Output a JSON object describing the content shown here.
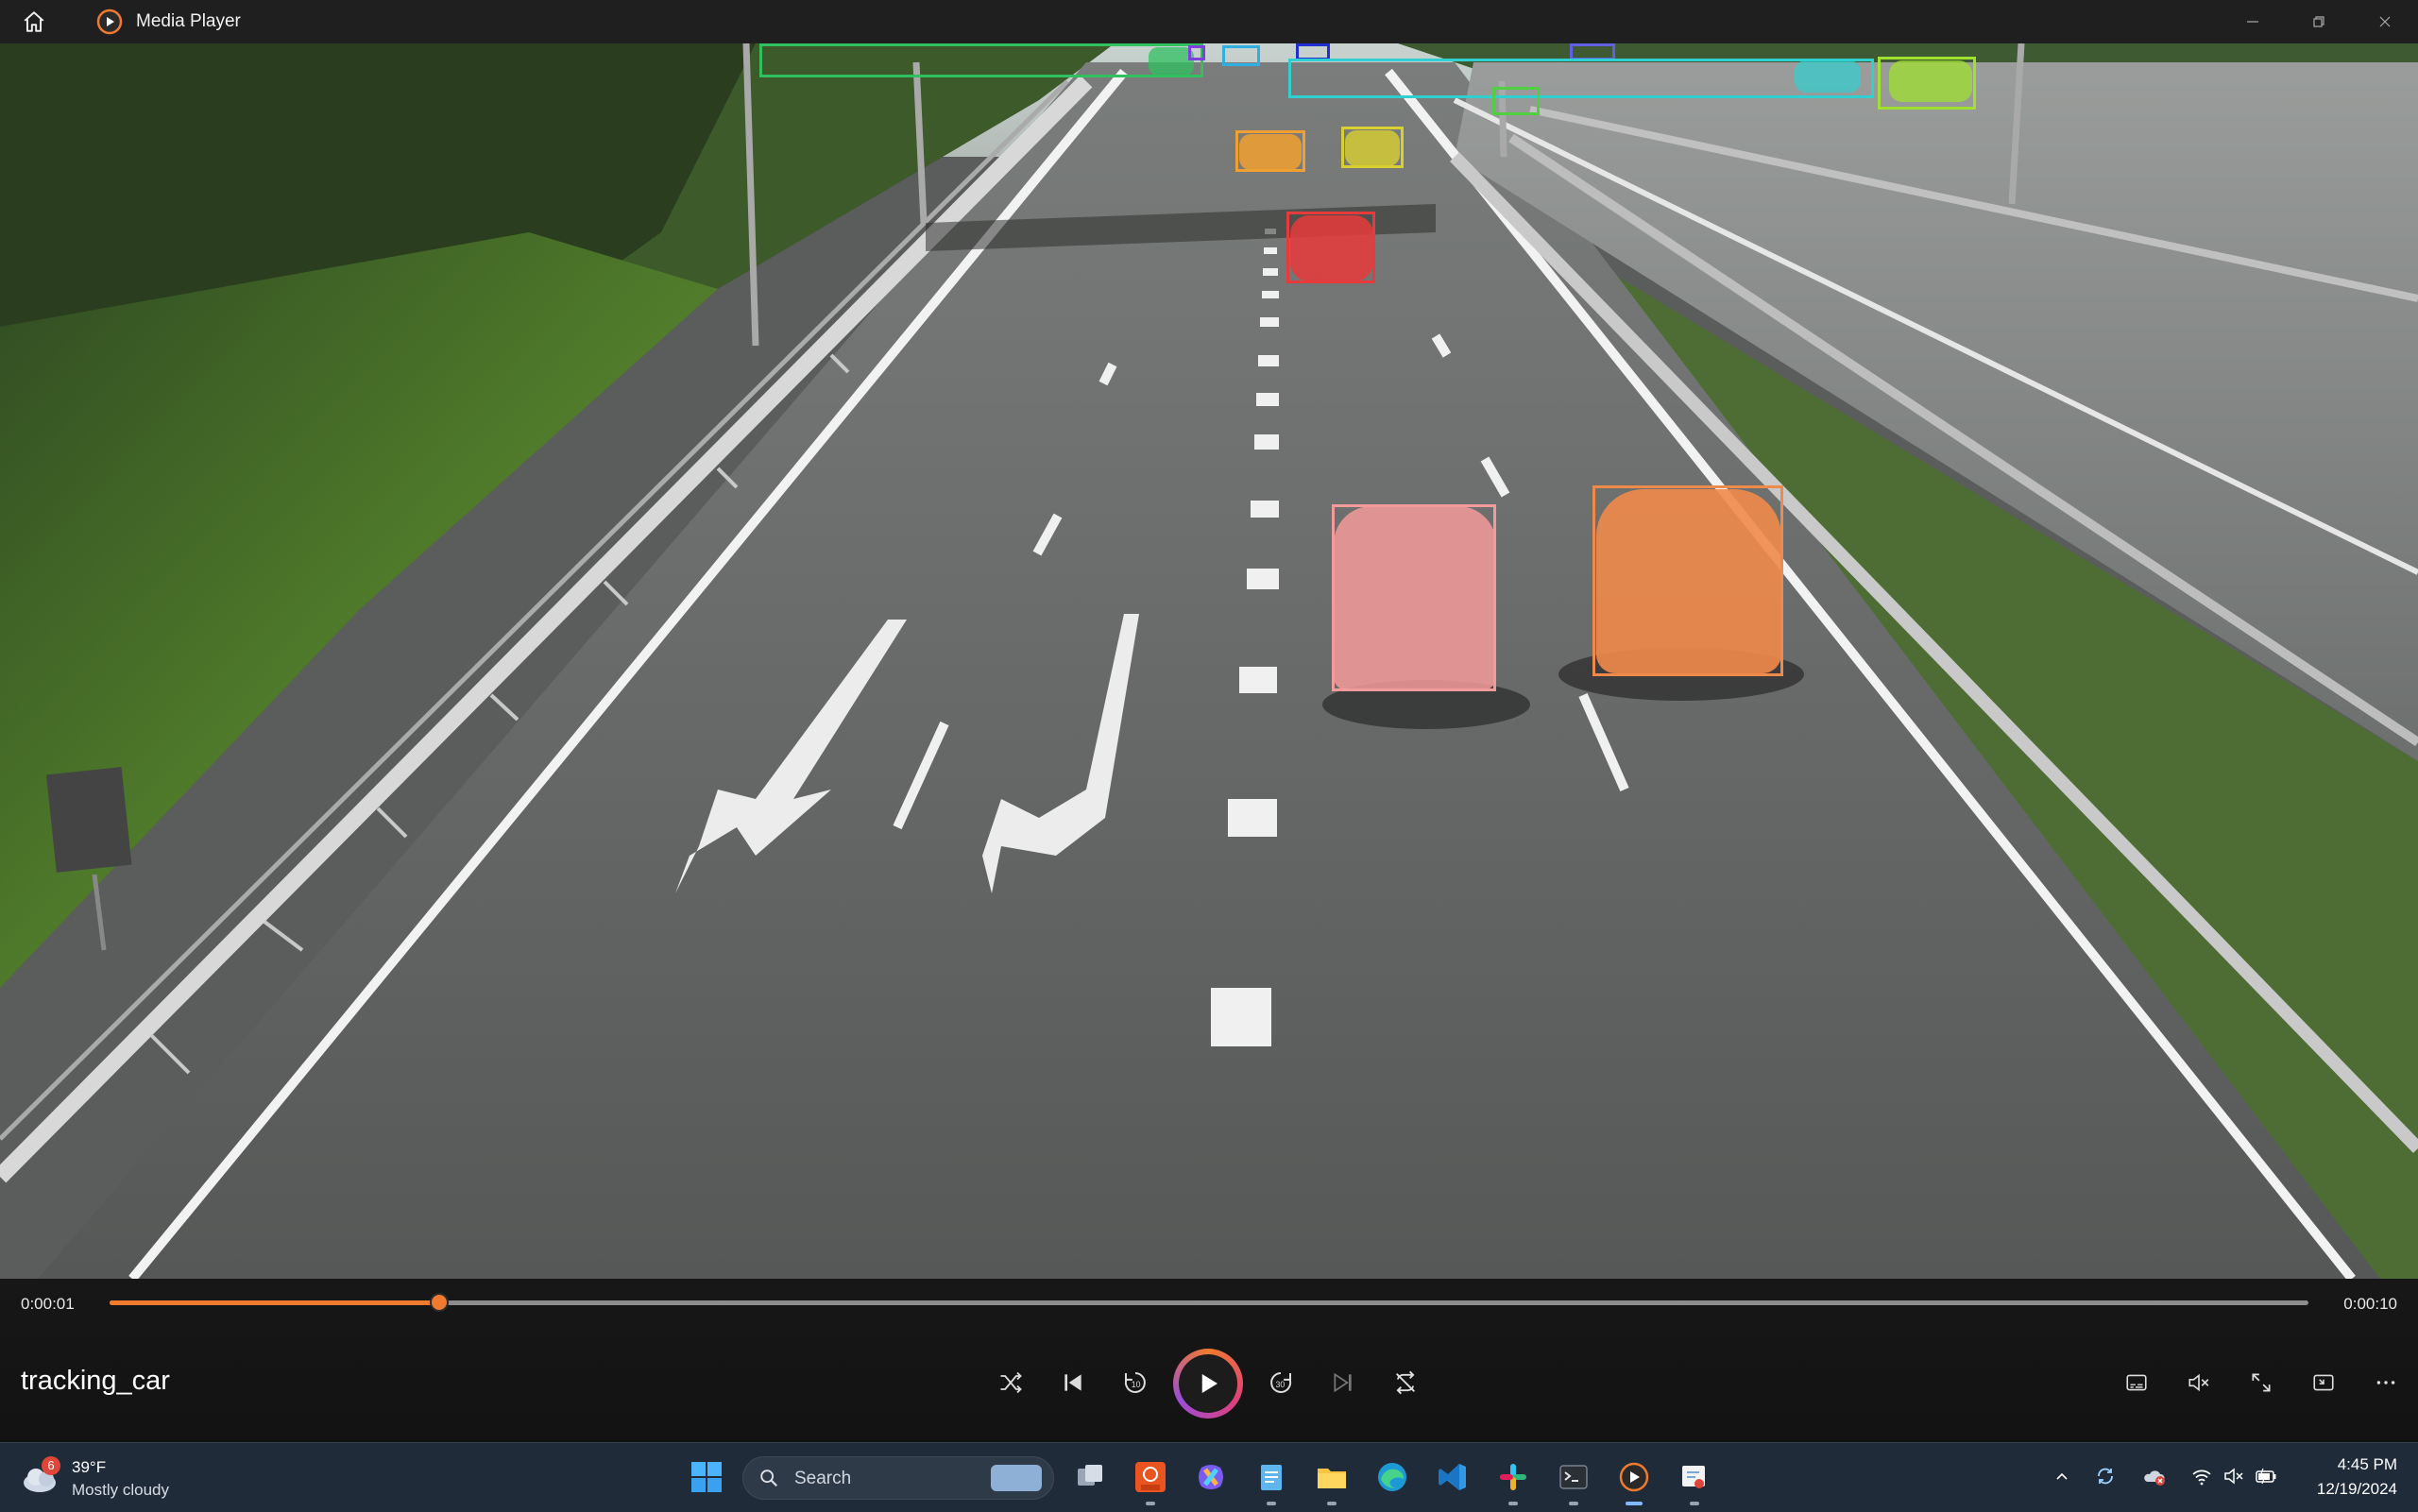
{
  "window": {
    "title": "Media Player"
  },
  "player": {
    "media_title": "tracking_car",
    "current_time": "0:00:01",
    "total_time": "0:00:10",
    "progress_percent": 15,
    "colors": {
      "accent": "#f07a2e",
      "play_ring": [
        "#f07a2e",
        "#e0407a",
        "#9c4dd6"
      ]
    }
  },
  "video": {
    "detections": [
      {
        "name": "car-pink",
        "color": "#f49a9a"
      },
      {
        "name": "car-orange",
        "color": "#f08a4a"
      },
      {
        "name": "car-red",
        "color": "#e83a3a"
      },
      {
        "name": "car-gold",
        "color": "#f0a030"
      },
      {
        "name": "car-yellow",
        "color": "#d8d030"
      },
      {
        "name": "car-green-left",
        "color": "#30c060"
      },
      {
        "name": "car-cyan-1",
        "color": "#30b0e0"
      },
      {
        "name": "car-blue",
        "color": "#2030d0"
      },
      {
        "name": "car-purple",
        "color": "#8040e0"
      },
      {
        "name": "car-lime",
        "color": "#50d040"
      },
      {
        "name": "car-cyan-far",
        "color": "#30d0d0"
      },
      {
        "name": "car-chartreuse",
        "color": "#a0e030"
      },
      {
        "name": "car-violet-far",
        "color": "#6060e0"
      }
    ]
  },
  "taskbar": {
    "weather": {
      "temp": "39°F",
      "condition": "Mostly cloudy",
      "badge": "6"
    },
    "search_placeholder": "Search",
    "apps": [
      "task-view",
      "ubuntu-20-04",
      "copilot",
      "notepad",
      "file-explorer",
      "edge",
      "vscode",
      "slack",
      "terminal",
      "media-player",
      "snipping-tool"
    ],
    "clock": {
      "time": "4:45 PM",
      "date": "12/19/2024"
    }
  }
}
